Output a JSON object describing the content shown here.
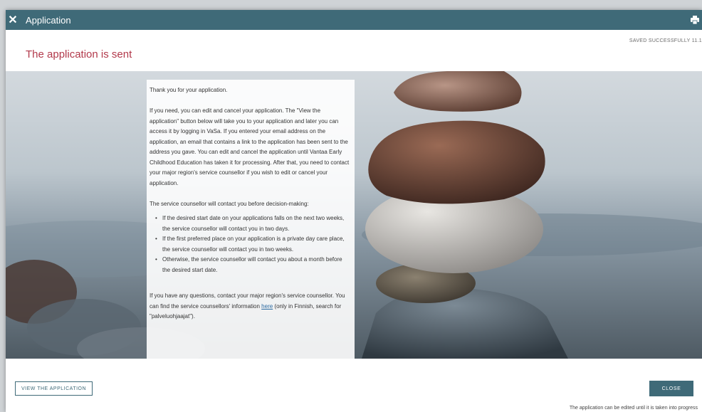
{
  "window": {
    "title": "Application",
    "close_symbol": "✕",
    "print_icon": "printer-icon"
  },
  "header": {
    "heading": "The application is sent",
    "saved_status": "SAVED SUCCESSFULLY 11.1"
  },
  "info": {
    "thanks": "Thank you for your application.",
    "edit_paragraph": "If you need, you can edit and cancel your application. The \"View the application\" button below will take you to your application and later you can access it by logging in VaSa. If you entered your email address on the application, an email that contains a link to the application has been sent to the address you gave. You can edit and cancel the application until Vantaa Early Childhood Education has taken it for processing. After that, you need to contact your major region's service counsellor if you wish to edit or cancel your application.",
    "counsellor_intro": "The service counsellor will contact you before decision-making:",
    "bullets": [
      "If the desired start date on your applications falls on the next two weeks, the service counsellor will contact you in two days.",
      "If the first preferred place on your application is a private day care place, the service counsellor will contact you in two weeks.",
      "Otherwise, the service counsellor will contact you about a month before the desired start date."
    ],
    "questions_before_link": "If you have any questions, contact your major region's service counsellor. You can find the service counsellors' information ",
    "questions_link": "here",
    "questions_after_link": " (only in Finnish, search for \"palveluohjaajat\")."
  },
  "footer": {
    "view_button": "VIEW THE APPLICATION",
    "close_button": "CLOSE",
    "edit_note": "The application can be edited until it is taken into progress"
  },
  "colors": {
    "titlebar": "#3f6a78",
    "heading": "#b2394b",
    "accent": "#3f6a78"
  }
}
